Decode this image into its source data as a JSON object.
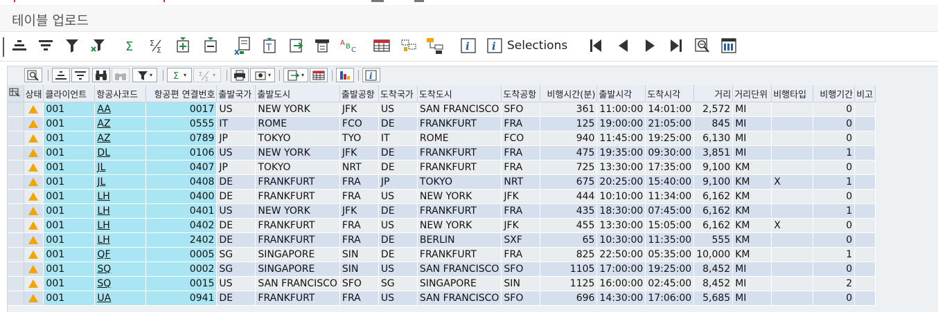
{
  "window": {
    "title": "테이블 업로드"
  },
  "toolbar": {
    "selections_label": "Selections"
  },
  "grid": {
    "columns": [
      "상태",
      "클라이언트",
      "항공사코드",
      "항공편 연결번호",
      "출발국가",
      "출발도시",
      "출발공항",
      "도착국가",
      "도착도시",
      "도착공항",
      "비행시간(분)",
      "출발시각",
      "도착시각",
      "거리",
      "거리단위",
      "비행타입",
      "비행기간",
      "비고"
    ],
    "rows": [
      [
        "",
        "001",
        "AA",
        "0017",
        "US",
        "NEW YORK",
        "JFK",
        "US",
        "SAN FRANCISCO",
        "SFO",
        "361",
        "11:00:00",
        "14:01:00",
        "2,572",
        "MI",
        "",
        "0",
        ""
      ],
      [
        "",
        "001",
        "AZ",
        "0555",
        "IT",
        "ROME",
        "FCO",
        "DE",
        "FRANKFURT",
        "FRA",
        "125",
        "19:00:00",
        "21:05:00",
        "845",
        "MI",
        "",
        "0",
        ""
      ],
      [
        "",
        "001",
        "AZ",
        "0789",
        "JP",
        "TOKYO",
        "TYO",
        "IT",
        "ROME",
        "FCO",
        "940",
        "11:45:00",
        "19:25:00",
        "6,130",
        "MI",
        "",
        "0",
        ""
      ],
      [
        "",
        "001",
        "DL",
        "0106",
        "US",
        "NEW YORK",
        "JFK",
        "DE",
        "FRANKFURT",
        "FRA",
        "475",
        "19:35:00",
        "09:30:00",
        "3,851",
        "MI",
        "",
        "1",
        ""
      ],
      [
        "",
        "001",
        "JL",
        "0407",
        "JP",
        "TOKYO",
        "NRT",
        "DE",
        "FRANKFURT",
        "FRA",
        "725",
        "13:30:00",
        "17:35:00",
        "9,100",
        "KM",
        "",
        "0",
        ""
      ],
      [
        "",
        "001",
        "JL",
        "0408",
        "DE",
        "FRANKFURT",
        "FRA",
        "JP",
        "TOKYO",
        "NRT",
        "675",
        "20:25:00",
        "15:40:00",
        "9,100",
        "KM",
        "X",
        "1",
        ""
      ],
      [
        "",
        "001",
        "LH",
        "0400",
        "DE",
        "FRANKFURT",
        "FRA",
        "US",
        "NEW YORK",
        "JFK",
        "444",
        "10:10:00",
        "11:34:00",
        "6,162",
        "KM",
        "",
        "0",
        ""
      ],
      [
        "",
        "001",
        "LH",
        "0401",
        "US",
        "NEW YORK",
        "JFK",
        "DE",
        "FRANKFURT",
        "FRA",
        "435",
        "18:30:00",
        "07:45:00",
        "6,162",
        "KM",
        "",
        "1",
        ""
      ],
      [
        "",
        "001",
        "LH",
        "0402",
        "DE",
        "FRANKFURT",
        "FRA",
        "US",
        "NEW YORK",
        "JFK",
        "455",
        "13:30:00",
        "15:05:00",
        "6,162",
        "KM",
        "X",
        "0",
        ""
      ],
      [
        "",
        "001",
        "LH",
        "2402",
        "DE",
        "FRANKFURT",
        "FRA",
        "DE",
        "BERLIN",
        "SXF",
        "65",
        "10:30:00",
        "11:35:00",
        "555",
        "KM",
        "",
        "0",
        ""
      ],
      [
        "",
        "001",
        "QF",
        "0005",
        "SG",
        "SINGAPORE",
        "SIN",
        "DE",
        "FRANKFURT",
        "FRA",
        "825",
        "22:50:00",
        "05:35:00",
        "10,000",
        "KM",
        "",
        "1",
        ""
      ],
      [
        "",
        "001",
        "SQ",
        "0002",
        "SG",
        "SINGAPORE",
        "SIN",
        "US",
        "SAN FRANCISCO",
        "SFO",
        "1105",
        "17:00:00",
        "19:25:00",
        "8,452",
        "MI",
        "",
        "0",
        ""
      ],
      [
        "",
        "001",
        "SQ",
        "0015",
        "US",
        "SAN FRANCISCO",
        "SFO",
        "SG",
        "SINGAPORE",
        "SIN",
        "1125",
        "16:00:00",
        "02:45:00",
        "8,452",
        "MI",
        "",
        "2",
        ""
      ],
      [
        "",
        "001",
        "UA",
        "0941",
        "DE",
        "FRANKFURT",
        "FRA",
        "US",
        "SAN FRANCISCO",
        "SFO",
        "696",
        "14:30:00",
        "17:06:00",
        "5,685",
        "MI",
        "",
        "0",
        ""
      ]
    ]
  },
  "colors": {
    "key_cell": "#a9e5f2",
    "row_odd": "#eaedf0",
    "row_even": "#d5dfee",
    "warning_icon": "#f0a500",
    "icon_dark": "#333333",
    "icon_green": "#1d8a3a",
    "icon_blue": "#1f5fa8"
  }
}
